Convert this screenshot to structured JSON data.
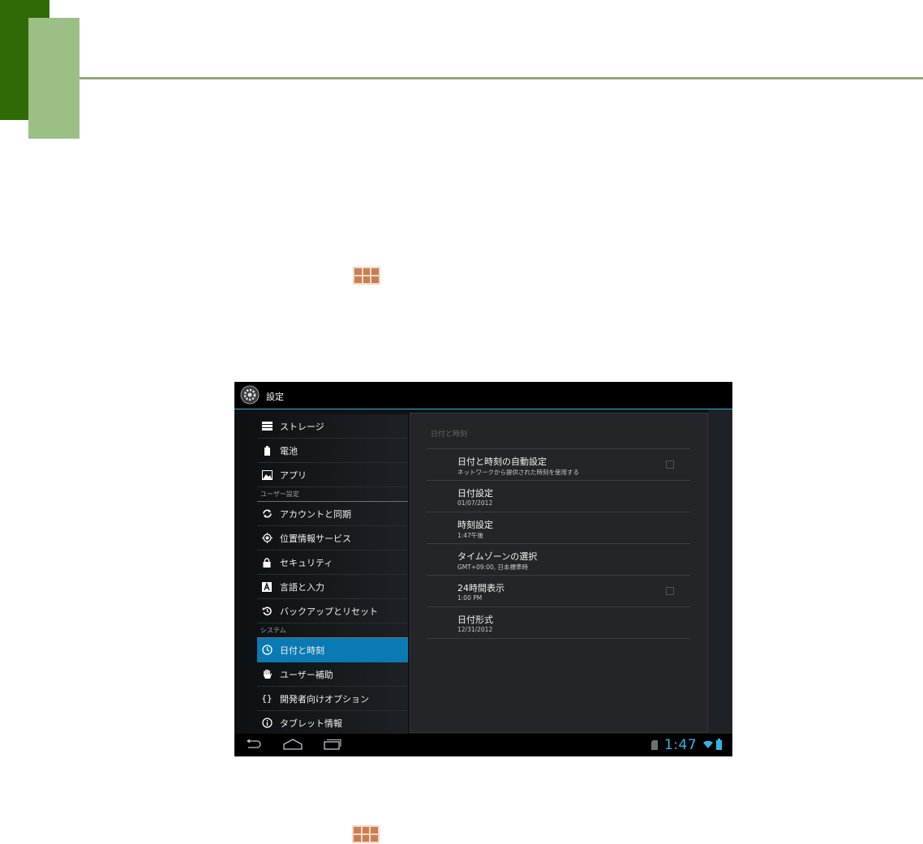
{
  "settings": {
    "title": "設定",
    "sidebar": {
      "items": [
        {
          "label": "ストレージ",
          "icon": "storage-icon"
        },
        {
          "label": "電池",
          "icon": "battery-icon"
        },
        {
          "label": "アプリ",
          "icon": "apps-icon"
        },
        {
          "label": "アカウントと同期",
          "icon": "sync-icon"
        },
        {
          "label": "位置情報サービス",
          "icon": "location-icon"
        },
        {
          "label": "セキュリティ",
          "icon": "lock-icon"
        },
        {
          "label": "言語と入力",
          "icon": "language-icon"
        },
        {
          "label": "バックアップとリセット",
          "icon": "backup-icon"
        },
        {
          "label": "日付と時刻",
          "icon": "clock-icon",
          "selected": true
        },
        {
          "label": "ユーザー補助",
          "icon": "hand-icon"
        },
        {
          "label": "開発者向けオプション",
          "icon": "braces-icon"
        },
        {
          "label": "タブレット情報",
          "icon": "info-icon"
        }
      ],
      "sections": {
        "user": "ユーザー設定",
        "system": "システム"
      }
    },
    "detail": {
      "title": "日付と時刻",
      "rows": [
        {
          "title": "日付と時刻の自動設定",
          "summary": "ネットワークから提供された時刻を使用する",
          "checkbox": true,
          "checked": false
        },
        {
          "title": "日付設定",
          "summary": "01/07/2012"
        },
        {
          "title": "時刻設定",
          "summary": "1:47午後"
        },
        {
          "title": "タイムゾーンの選択",
          "summary": "GMT+09:00, 日本標準時"
        },
        {
          "title": "24時間表示",
          "summary": "1:00 PM",
          "checkbox": true,
          "checked": false
        },
        {
          "title": "日付形式",
          "summary": "12/31/2012"
        }
      ]
    },
    "status": {
      "time": "1:47"
    }
  },
  "colors": {
    "accent": "#33b5e5",
    "selected": "#0a7ab4",
    "doc_dark_green": "#2f6a06",
    "doc_light_green": "#9bbf84"
  }
}
